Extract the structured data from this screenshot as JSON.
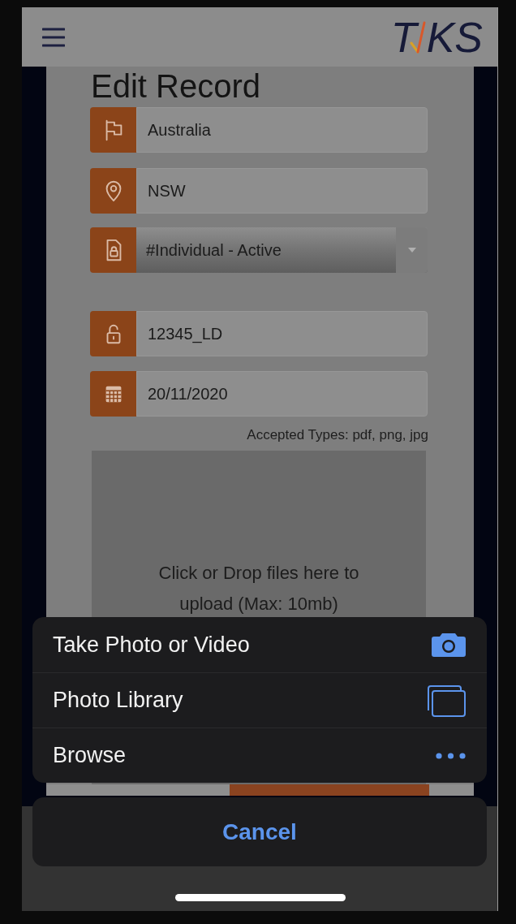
{
  "header": {
    "logo": {
      "before_mark": "T",
      "after_mark": "KS"
    }
  },
  "modal": {
    "title": "Edit Record",
    "fields": [
      {
        "kind": "input",
        "value": "Australia"
      },
      {
        "kind": "input",
        "value": "NSW"
      },
      {
        "kind": "select",
        "value": "#Individual - Active"
      },
      {
        "kind": "input",
        "value": "12345_LD"
      },
      {
        "kind": "input",
        "value": "20/11/2020"
      }
    ],
    "accepted_types": "Accepted Types: pdf, png, jpg",
    "dropzone": {
      "text": "Click or Drop files here to upload (Max: 10mb)"
    }
  },
  "action_sheet": {
    "options": [
      {
        "label": "Take Photo or Video"
      },
      {
        "label": "Photo Library"
      },
      {
        "label": "Browse"
      }
    ],
    "cancel": "Cancel"
  }
}
